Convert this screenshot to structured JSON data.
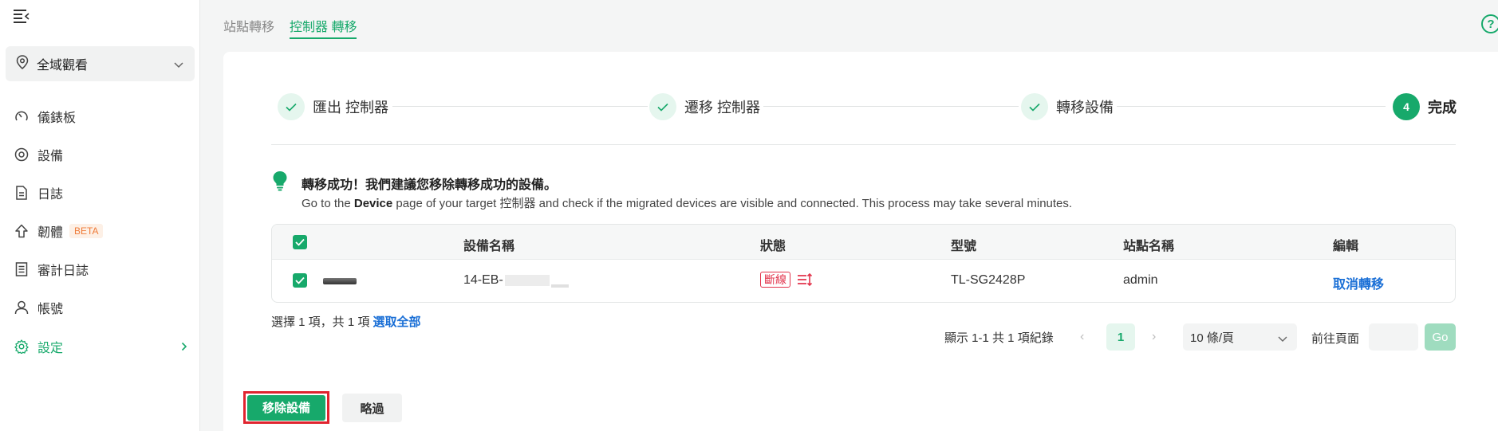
{
  "sidebar": {
    "scope_label": "全域觀看",
    "items": [
      {
        "label": "儀錶板"
      },
      {
        "label": "設備"
      },
      {
        "label": "日誌"
      },
      {
        "label": "韌體",
        "badge": "BETA"
      },
      {
        "label": "審計日誌"
      },
      {
        "label": "帳號"
      },
      {
        "label": "設定"
      }
    ]
  },
  "tabs": [
    {
      "label": "站點轉移"
    },
    {
      "label": "控制器 轉移"
    }
  ],
  "help_label": "?",
  "steps": [
    {
      "label": "匯出 控制器",
      "state": "done"
    },
    {
      "label": "遷移 控制器",
      "state": "done"
    },
    {
      "label": "轉移設備",
      "state": "done"
    },
    {
      "label": "完成",
      "number": "4",
      "state": "current"
    }
  ],
  "message": {
    "title": "轉移成功！我們建議您移除轉移成功的設備。",
    "body_prefix": "Go to the ",
    "body_bold": "Device",
    "body_suffix": " page of your target 控制器 and check if the migrated devices are visible and connected. This process may take several minutes."
  },
  "table": {
    "headers": {
      "name": "設備名稱",
      "status": "狀態",
      "model": "型號",
      "site": "站點名稱",
      "edit": "編輯"
    },
    "rows": [
      {
        "name": "14-EB-",
        "status": "斷線",
        "model": "TL-SG2428P",
        "site": "admin",
        "action": "取消轉移"
      }
    ]
  },
  "selection": {
    "text": "選擇 1 項，共 1 項",
    "select_all": "選取全部"
  },
  "pagination": {
    "total_text": "顯示 1-1 共 1 項紀錄",
    "prev": "‹",
    "next": "›",
    "current_page": "1",
    "page_size": "10 條/頁",
    "goto_label": "前往頁面",
    "go_label": "Go"
  },
  "actions": {
    "remove": "移除設備",
    "skip": "略過"
  },
  "colors": {
    "accent": "#17a96b",
    "danger": "#e2344c",
    "link": "#1a6fd6"
  }
}
